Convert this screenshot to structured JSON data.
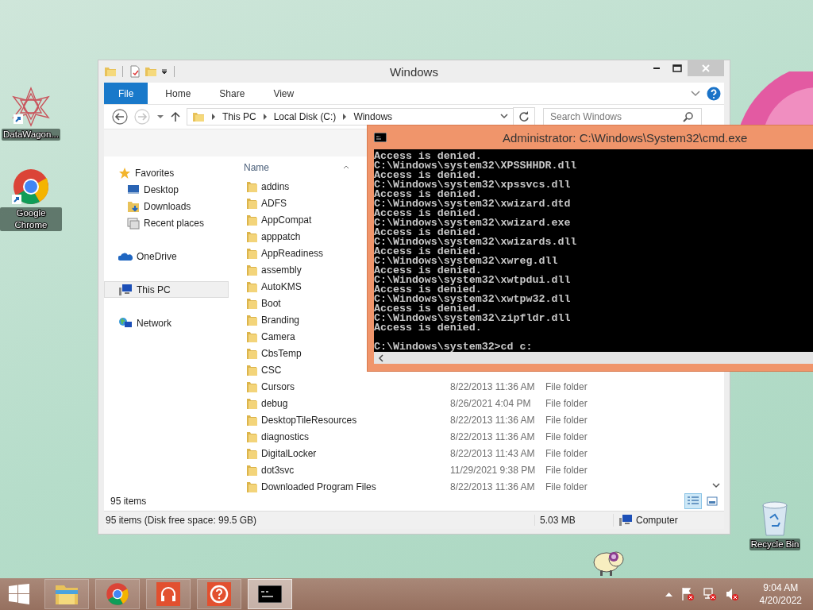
{
  "desktop": {
    "icons": [
      {
        "label": "DataWagon...",
        "kind": "star-app"
      },
      {
        "label": "Google Chrome",
        "kind": "chrome"
      },
      {
        "label": "Recycle Bin",
        "kind": "recycle"
      }
    ]
  },
  "explorer": {
    "title": "Windows",
    "ribbon_tabs": [
      {
        "label": "File",
        "selected": true
      },
      {
        "label": "Home",
        "selected": false
      },
      {
        "label": "Share",
        "selected": false
      },
      {
        "label": "View",
        "selected": false
      }
    ],
    "nav_buttons": [
      {
        "kind": "back",
        "disabled": false
      },
      {
        "kind": "forward",
        "disabled": true
      }
    ],
    "address": {
      "crumbs": [
        "This PC",
        "Local Disk (C:)",
        "Windows"
      ]
    },
    "search": {
      "placeholder": "Search Windows"
    },
    "sidebar": [
      {
        "label": "Favorites",
        "kind": "star",
        "selected": false,
        "children": [
          {
            "label": "Desktop",
            "kind": "desktop",
            "selected": false
          },
          {
            "label": "Downloads",
            "kind": "downloads",
            "selected": false
          },
          {
            "label": "Recent places",
            "kind": "recent",
            "selected": false
          }
        ]
      },
      {
        "label": "OneDrive",
        "kind": "cloud",
        "selected": false
      },
      {
        "label": "This PC",
        "kind": "pc",
        "selected": true
      },
      {
        "label": "Network",
        "kind": "network",
        "selected": false
      }
    ],
    "list": {
      "name_column": "Name",
      "rows": [
        {
          "name": "addins"
        },
        {
          "name": "ADFS"
        },
        {
          "name": "AppCompat"
        },
        {
          "name": "apppatch"
        },
        {
          "name": "AppReadiness"
        },
        {
          "name": "assembly"
        },
        {
          "name": "AutoKMS"
        },
        {
          "name": "Boot"
        },
        {
          "name": "Branding"
        },
        {
          "name": "Camera"
        },
        {
          "name": "CbsTemp"
        },
        {
          "name": "CSC"
        },
        {
          "name": "Cursors",
          "date": "8/22/2013 11:36 AM",
          "type": "File folder"
        },
        {
          "name": "debug",
          "date": "8/26/2021 4:04 PM",
          "type": "File folder"
        },
        {
          "name": "DesktopTileResources",
          "date": "8/22/2013 11:36 AM",
          "type": "File folder"
        },
        {
          "name": "diagnostics",
          "date": "8/22/2013 11:36 AM",
          "type": "File folder"
        },
        {
          "name": "DigitalLocker",
          "date": "8/22/2013 11:43 AM",
          "type": "File folder"
        },
        {
          "name": "dot3svc",
          "date": "11/29/2021 9:38 PM",
          "type": "File folder"
        },
        {
          "name": "Downloaded Program Files",
          "date": "8/22/2013 11:36 AM",
          "type": "File folder"
        }
      ]
    },
    "item_count": "95 items",
    "views": [
      {
        "kind": "details",
        "selected": true
      },
      {
        "kind": "tiles",
        "selected": false
      }
    ],
    "status_bar": {
      "summary": "95 items (Disk free space: 99.5 GB)",
      "size": "5.03 MB",
      "location": "Computer"
    }
  },
  "cmd": {
    "title": "Administrator: C:\\Windows\\System32\\cmd.exe",
    "lines": [
      "Access is denied.",
      "C:\\Windows\\system32\\XPSSHHDR.dll",
      "Access is denied.",
      "C:\\Windows\\system32\\xpssvcs.dll",
      "Access is denied.",
      "C:\\Windows\\system32\\xwizard.dtd",
      "Access is denied.",
      "C:\\Windows\\system32\\xwizard.exe",
      "Access is denied.",
      "C:\\Windows\\system32\\xwizards.dll",
      "Access is denied.",
      "C:\\Windows\\system32\\xwreg.dll",
      "Access is denied.",
      "C:\\Windows\\system32\\xwtpdui.dll",
      "Access is denied.",
      "C:\\Windows\\system32\\xwtpw32.dll",
      "Access is denied.",
      "C:\\Windows\\system32\\zipfldr.dll",
      "Access is denied."
    ],
    "prompt": "C:\\Windows\\system32>cd c:"
  },
  "taskbar": {
    "items": [
      {
        "kind": "explorer",
        "selected": false
      },
      {
        "kind": "chrome",
        "selected": false
      },
      {
        "kind": "headphones",
        "selected": false
      },
      {
        "kind": "help",
        "selected": false
      },
      {
        "kind": "console",
        "selected": true
      }
    ],
    "time": "9:04 AM",
    "date": "4/20/2022"
  }
}
